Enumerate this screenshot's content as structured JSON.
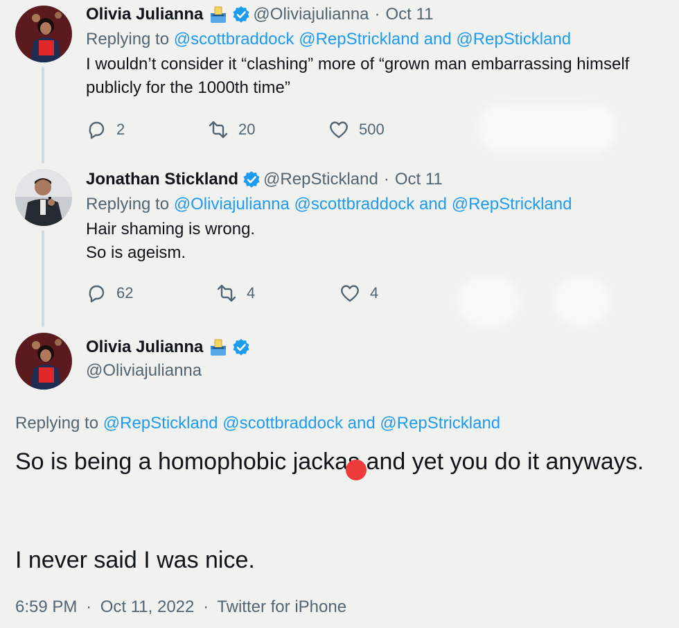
{
  "tweets": [
    {
      "display_name": "Olivia Julianna",
      "emoji": "ballot-box-emoji",
      "handle": "@Oliviajulianna",
      "dot": "·",
      "date": "Oct 11",
      "replying_prefix": "Replying to",
      "mentions": [
        "@scottbraddock",
        "@RepStrickland"
      ],
      "and": "and",
      "last_mention": "@RepStickland",
      "text": "I wouldn’t consider it “clashing” more of “grown man embarrassing himself publicly for the 1000th time”",
      "replies": "2",
      "retweets": "20",
      "likes": "500"
    },
    {
      "display_name": "Jonathan Stickland",
      "handle": "@RepStickland",
      "dot": "·",
      "date": "Oct 11",
      "replying_prefix": "Replying to",
      "mentions": [
        "@Oliviajulianna",
        "@scottbraddock"
      ],
      "and": "and",
      "last_mention": "@RepStrickland",
      "text_line1": "Hair shaming is wrong.",
      "text_line2": "So is ageism.",
      "replies": "62",
      "retweets": "4",
      "likes": "4"
    }
  ],
  "main": {
    "display_name": "Olivia Julianna",
    "emoji": "ballot-box-emoji",
    "handle": "@Oliviajulianna",
    "replying_prefix": "Replying to",
    "mentions": [
      "@RepStickland",
      "@scottbraddock"
    ],
    "and": "and",
    "last_mention": "@RepStrickland",
    "text_a": "So is being a homophobic jackas",
    "text_b": " and yet you do it anyways.",
    "text_2": "I never said I was nice.",
    "time": "6:59 PM",
    "dot": "·",
    "date": "Oct 11, 2022",
    "source": "Twitter for iPhone"
  },
  "colors": {
    "accent": "#1d9bf0",
    "secondary_text": "#536471",
    "background": "#f1f1f0",
    "redaction": "#ee3b3b"
  }
}
